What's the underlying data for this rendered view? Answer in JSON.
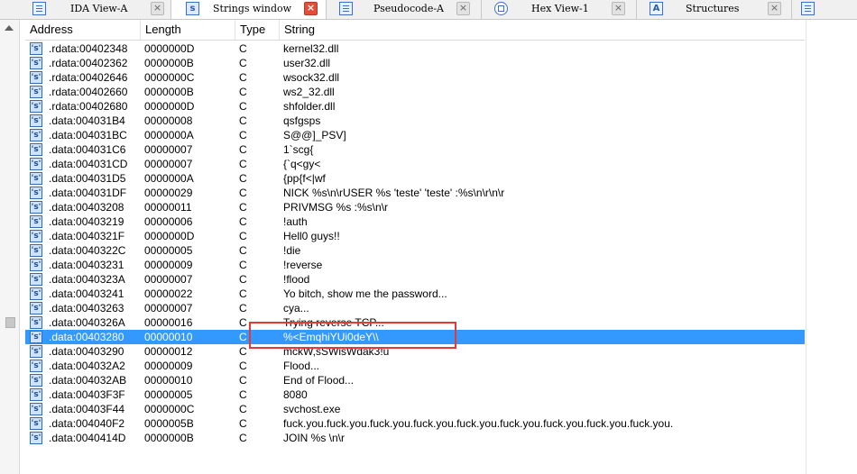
{
  "tabs": [
    {
      "label": "IDA View-A",
      "icon": "doc-icon",
      "active": false
    },
    {
      "label": "Strings window",
      "icon": "string-icon",
      "active": true
    },
    {
      "label": "Pseudocode-A",
      "icon": "doc-icon",
      "active": false
    },
    {
      "label": "Hex View-1",
      "icon": "hex-icon",
      "active": false
    },
    {
      "label": "Structures",
      "icon": "struct-icon",
      "active": false
    }
  ],
  "close_glyph": "×",
  "table": {
    "headers": [
      "Address",
      "Length",
      "Type",
      "String"
    ],
    "selected_row": 20,
    "rows": [
      {
        "address": ".rdata:00402348",
        "length": "0000000D",
        "type": "C",
        "string": "kernel32.dll"
      },
      {
        "address": ".rdata:00402362",
        "length": "0000000B",
        "type": "C",
        "string": "user32.dll"
      },
      {
        "address": ".rdata:00402646",
        "length": "0000000C",
        "type": "C",
        "string": "wsock32.dll"
      },
      {
        "address": ".rdata:00402660",
        "length": "0000000B",
        "type": "C",
        "string": "ws2_32.dll"
      },
      {
        "address": ".rdata:00402680",
        "length": "0000000D",
        "type": "C",
        "string": "shfolder.dll"
      },
      {
        "address": ".data:004031B4",
        "length": "00000008",
        "type": "C",
        "string": "qsfgsps"
      },
      {
        "address": ".data:004031BC",
        "length": "0000000A",
        "type": "C",
        "string": "S@@]_PSV]"
      },
      {
        "address": ".data:004031C6",
        "length": "00000007",
        "type": "C",
        "string": "1`scg{"
      },
      {
        "address": ".data:004031CD",
        "length": "00000007",
        "type": "C",
        "string": "{`q<gy<"
      },
      {
        "address": ".data:004031D5",
        "length": "0000000A",
        "type": "C",
        "string": "{pp{f<|wf"
      },
      {
        "address": ".data:004031DF",
        "length": "00000029",
        "type": "C",
        "string": "NICK %s\\n\\rUSER %s 'teste' 'teste' :%s\\n\\r\\n\\r"
      },
      {
        "address": ".data:00403208",
        "length": "00000011",
        "type": "C",
        "string": "PRIVMSG %s :%s\\n\\r"
      },
      {
        "address": ".data:00403219",
        "length": "00000006",
        "type": "C",
        "string": "!auth"
      },
      {
        "address": ".data:0040321F",
        "length": "0000000D",
        "type": "C",
        "string": "Hell0 guys!!"
      },
      {
        "address": ".data:0040322C",
        "length": "00000005",
        "type": "C",
        "string": "!die"
      },
      {
        "address": ".data:00403231",
        "length": "00000009",
        "type": "C",
        "string": "!reverse"
      },
      {
        "address": ".data:0040323A",
        "length": "00000007",
        "type": "C",
        "string": "!flood"
      },
      {
        "address": ".data:00403241",
        "length": "00000022",
        "type": "C",
        "string": "Yo bitch, show me the password..."
      },
      {
        "address": ".data:00403263",
        "length": "00000007",
        "type": "C",
        "string": "cya..."
      },
      {
        "address": ".data:0040326A",
        "length": "00000016",
        "type": "C",
        "string": "Trying reverse TCP..."
      },
      {
        "address": ".data:00403280",
        "length": "00000010",
        "type": "C",
        "string": "%<EmqhiYUi0deY\\\\"
      },
      {
        "address": ".data:00403290",
        "length": "00000012",
        "type": "C",
        "string": "mckW,sSWisWdak3!u"
      },
      {
        "address": ".data:004032A2",
        "length": "00000009",
        "type": "C",
        "string": "Flood..."
      },
      {
        "address": ".data:004032AB",
        "length": "00000010",
        "type": "C",
        "string": "End of Flood..."
      },
      {
        "address": ".data:00403F3F",
        "length": "00000005",
        "type": "C",
        "string": "8080"
      },
      {
        "address": ".data:00403F44",
        "length": "0000000C",
        "type": "C",
        "string": "svchost.exe"
      },
      {
        "address": ".data:004040F2",
        "length": "0000005B",
        "type": "C",
        "string": "fuck.you.fuck.you.fuck.you.fuck.you.fuck.you.fuck.you.fuck.you.fuck.you.fuck.you."
      },
      {
        "address": ".data:0040414D",
        "length": "0000000B",
        "type": "C",
        "string": "JOIN %s \\n\\r"
      }
    ]
  },
  "row_icon_glyph": "'s'",
  "colors": {
    "selection": "#3399ff",
    "annotation_box": "#e53935",
    "active_close": "#e84b36"
  }
}
